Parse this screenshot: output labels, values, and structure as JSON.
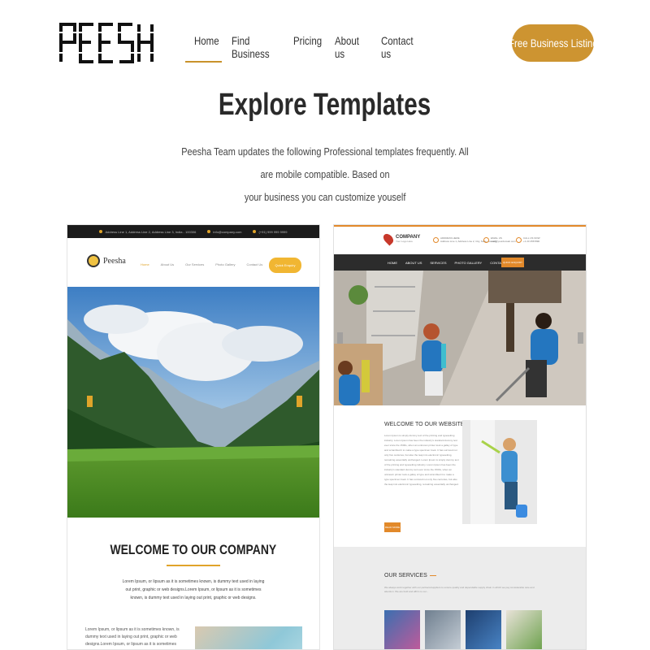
{
  "header": {
    "logo_text": "PEESHA",
    "nav": [
      {
        "label": "Home",
        "active": true
      },
      {
        "label": "Find Business"
      },
      {
        "label": "Pricing"
      },
      {
        "label": "About us"
      },
      {
        "label": "Contact us"
      }
    ],
    "cta_label": "Free Business Listing"
  },
  "hero": {
    "title": "Explore Templates",
    "subtitle_line1": "Peesha Team updates the following Professional templates frequently. All are mobile compatible. Based on",
    "subtitle_line2": "your business you can customize youself"
  },
  "colors": {
    "accent": "#cd9431",
    "dark": "#2a2a2a",
    "template2_accent": "#e2892a"
  },
  "template1": {
    "topbar_items": [
      "Address Line 1, Address Line 2, Address Line 3, India - 100306",
      "info@company.com",
      "(+91) 999 999 9999"
    ],
    "logo_text": "Peesha",
    "nav": [
      "Home",
      "About Us",
      "Our Services",
      "Photo Gallery",
      "Contact Us"
    ],
    "button": "Quick Enquiry",
    "welcome_title": "WELCOME TO OUR COMPANY",
    "welcome_text": "Lorem Ipsum, or lipsum as it is sometimes known, is dummy text used in laying out print, graphic or web designs.Lorem Ipsum, or lipsum as it is sometimes known, is dummy text used in laying out print, graphic or web designs.",
    "bottom_text": "Lorem Ipsum, or lipsum as it is sometimes known, is dummy text used in laying out print, graphic or web designs.Lorem Ipsum, or lipsum as it is sometimes known, is dummy text used in laying out print."
  },
  "template2": {
    "logo_title": "COMPANY",
    "logo_sub": "Your Logo Here",
    "info": [
      {
        "label": "ADDRESS HERE",
        "text": "Address Line 1, Address Line 2, City, State, Country"
      },
      {
        "label": "EMAIL US",
        "text": "mail@yourdomain.com"
      },
      {
        "label": "CALL US NOW",
        "text": "+1 23 4567890"
      }
    ],
    "nav": [
      "HOME",
      "ABOUT US",
      "SERVICES",
      "PHOTO GALLERY",
      "CONTACT US"
    ],
    "enquiry": "QUICK ENQUIRY",
    "about_title": "WELCOME TO OUR WEBSITE",
    "about_text": "Lorem Ipsum is simply dummy text of the printing and typesetting industry. Lorem Ipsum has been the industry's standard dummy text ever since the 1500s, when an unknown printer took a galley of type and scrambled it to make a type specimen book. It has survived not only five centuries, but also the leap into electronic typesetting, remaining essentially unchanged. Lorem Ipsum is simply dummy text of the printing and typesetting industry. Lorem Ipsum has been the industry's standard dummy text ever since the 1500s, when an unknown printer took a galley of type and scrambled it to make a type specimen book. It has survived not only five centuries, but also the leap into electronic typesetting, remaining essentially unchanged.",
    "read_more": "READ MORE",
    "services_title": "OUR SERVICES",
    "services_text": "We always work together with our partners/suppliers to ensure quality and dependable supply chain in which we pay considerable care and attention. We are bold and affirm to our..."
  }
}
